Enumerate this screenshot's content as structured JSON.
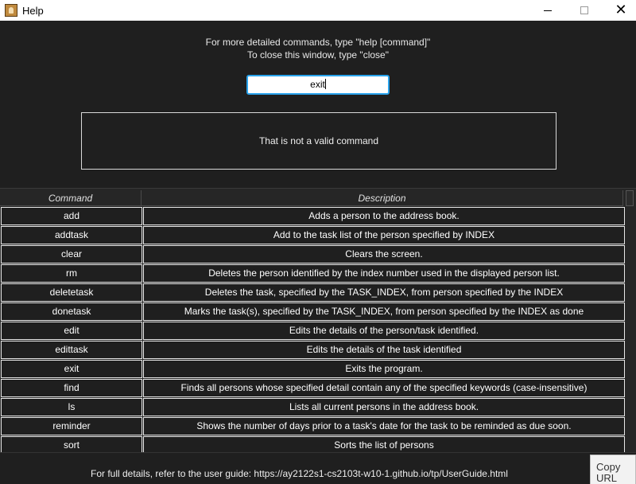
{
  "window": {
    "title": "Help",
    "app_icon": "duke-app-icon",
    "controls": {
      "minimize": "minimize-icon",
      "maximize": "maximize-icon",
      "close_glyph": "✕"
    }
  },
  "help": {
    "line1": "For more detailed commands, type \"help [command]\"",
    "line2": "To close this window, type \"close\""
  },
  "command_input": {
    "value": "exit"
  },
  "result": {
    "text": "That is not a valid command"
  },
  "table": {
    "headers": {
      "command": "Command",
      "description": "Description"
    },
    "rows": [
      {
        "command": "add",
        "description": "Adds a person to the address book."
      },
      {
        "command": "addtask",
        "description": "Add to the task list of the person specified by INDEX"
      },
      {
        "command": "clear",
        "description": "Clears the screen."
      },
      {
        "command": "rm",
        "description": "Deletes the person identified by the index number used in the displayed person list."
      },
      {
        "command": "deletetask",
        "description": "Deletes the task, specified by the TASK_INDEX, from person specified by the INDEX"
      },
      {
        "command": "donetask",
        "description": "Marks the task(s), specified by the TASK_INDEX, from person specified by the INDEX as done"
      },
      {
        "command": "edit",
        "description": "Edits the details of the person/task identified."
      },
      {
        "command": "edittask",
        "description": "Edits the details of the task identified"
      },
      {
        "command": "exit",
        "description": "Exits the program."
      },
      {
        "command": "find",
        "description": "Finds all persons whose specified detail contain any of the specified keywords (case-insensitive)"
      },
      {
        "command": "ls",
        "description": "Lists all current persons in the address book."
      },
      {
        "command": "reminder",
        "description": "Shows the number of days prior to a task's date for the task to be reminded as due soon."
      },
      {
        "command": "sort",
        "description": "Sorts the list of persons"
      }
    ]
  },
  "footer": {
    "text": "For full details, refer to the user guide: https://ay2122s1-cs2103t-w10-1.github.io/tp/UserGuide.html",
    "copy_button_label": "Copy URL"
  }
}
